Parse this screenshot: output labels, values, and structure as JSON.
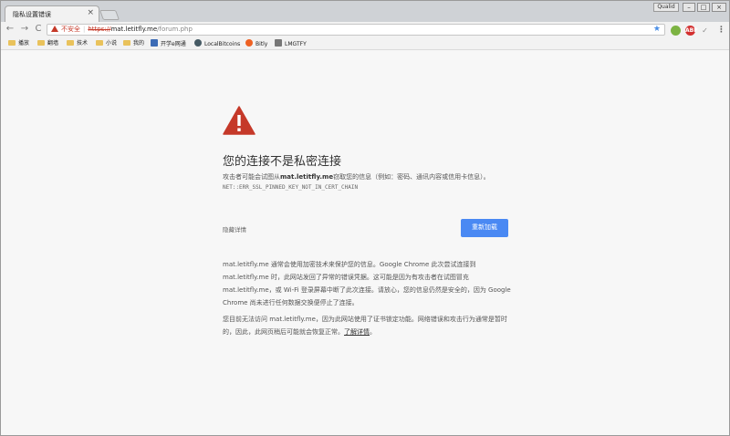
{
  "window": {
    "tab_title": "隐私设置错误",
    "tab_close": "×",
    "user_chip": "Qualid",
    "minimize": "–",
    "maximize": "□",
    "close": "×"
  },
  "toolbar": {
    "back": "←",
    "forward": "→",
    "reload": "C",
    "insecure_label": "不安全",
    "separator": "|",
    "scheme": "https://",
    "domain": "mat.letitfly.me",
    "path": "/forum.php",
    "star": "★",
    "menu": "⋮"
  },
  "extensions": {
    "ext2_label": "ABP",
    "check": "✓"
  },
  "bookmarks": [
    {
      "label": "播放",
      "icon": "folder"
    },
    {
      "label": "翻墙",
      "icon": "folder"
    },
    {
      "label": "技术",
      "icon": "folder"
    },
    {
      "label": "小说",
      "icon": "folder"
    },
    {
      "label": "我的",
      "icon": "folder"
    },
    {
      "label": "开学e网通",
      "icon": "page-icon"
    },
    {
      "label": "LocalBitcoins",
      "icon": "globe-icon"
    },
    {
      "label": "Bitly",
      "icon": "bitly-icon"
    },
    {
      "label": "LMGTFY",
      "icon": "lmgtfy-icon"
    }
  ],
  "page": {
    "title": "您的连接不是私密连接",
    "explain_before": "攻击者可能会试图从",
    "explain_domain": "mat.letitfly.me",
    "explain_after": "窃取您的信息（例如：密码、通讯内容或信用卡信息）。",
    "error_code": "NET::ERR_SSL_PINNED_KEY_NOT_IN_CERT_CHAIN",
    "details_label": "隐藏详情",
    "reload_label": "重新加载",
    "para1": "mat.letitfly.me 通常会使用加密技术来保护您的信息。Google Chrome 此次尝试连接到 mat.letitfly.me 时，此网站发回了异常的错误凭据。这可能是因为有攻击者在试图冒充 mat.letitfly.me，或 Wi-Fi 登录屏幕中断了此次连接。请放心，您的信息仍然是安全的，因为 Google Chrome 尚未进行任何数据交换便停止了连接。",
    "para2_text": "您目前无法访问 mat.letitfly.me，因为此网站使用了证书锁定功能。网络错误和攻击行为通常是暂时的，因此，此网页稍后可能就会恢复正常。",
    "para2_link": "了解详情",
    "para2_end": "。"
  },
  "colors": {
    "warning_red": "#c53929",
    "button_blue": "#4a89f3",
    "folder_yellow": "#e9c25b"
  }
}
